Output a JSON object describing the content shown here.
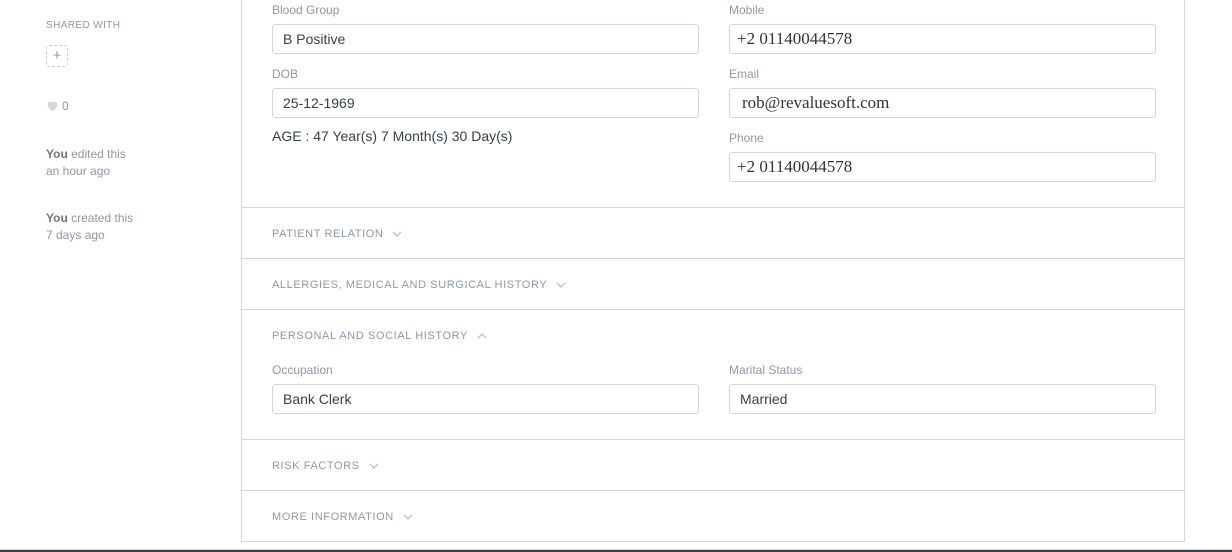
{
  "sidebar": {
    "shared_with_label": "SHARED WITH",
    "add_share_label": "+",
    "like_count": "0",
    "timeline": [
      {
        "actor": "You",
        "action": "edited this",
        "when": "an hour ago"
      },
      {
        "actor": "You",
        "action": "created this",
        "when": "7 days ago"
      }
    ]
  },
  "form": {
    "blood_group": {
      "label": "Blood Group",
      "value": "B Positive"
    },
    "mobile": {
      "label": "Mobile",
      "value": "+2 01140044578"
    },
    "dob": {
      "label": "DOB",
      "value": "25-12-1969"
    },
    "email": {
      "label": "Email",
      "value": "rob@revaluesoft.com"
    },
    "age_text": "AGE : 47 Year(s) 7 Month(s) 30 Day(s)",
    "phone": {
      "label": "Phone",
      "value": "+2 01140044578"
    }
  },
  "sections": {
    "patient_relation": {
      "title": "PATIENT RELATION",
      "expanded": false
    },
    "allergies": {
      "title": "ALLERGIES, MEDICAL AND SURGICAL HISTORY",
      "expanded": false
    },
    "personal_social": {
      "title": "PERSONAL AND SOCIAL HISTORY",
      "expanded": true,
      "occupation": {
        "label": "Occupation",
        "value": "Bank Clerk"
      },
      "marital_status": {
        "label": "Marital Status",
        "value": "Married"
      }
    },
    "risk_factors": {
      "title": "RISK FACTORS",
      "expanded": false
    },
    "more_information": {
      "title": "MORE INFORMATION",
      "expanded": false
    }
  },
  "icons": {
    "heart": "heart-icon",
    "chevron_down": "chevron-down-icon",
    "chevron_up": "chevron-up-icon"
  }
}
